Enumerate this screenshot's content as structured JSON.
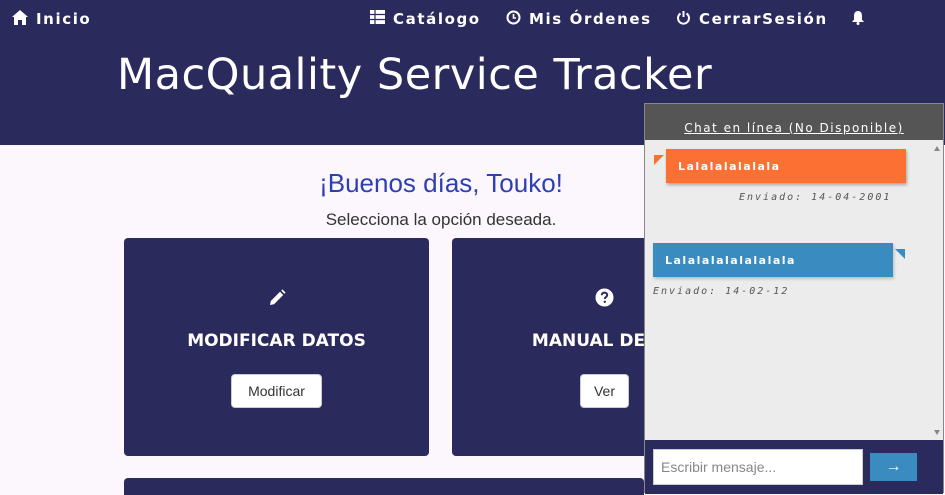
{
  "nav": {
    "home": {
      "label": "Inicio",
      "icon": "home-icon"
    },
    "catalog": {
      "label": "Catálogo",
      "icon": "grid-icon"
    },
    "orders": {
      "label": "Mis Órdenes",
      "icon": "clock-icon"
    },
    "logout": {
      "label": "CerrarSesión",
      "icon": "power-icon"
    },
    "notifications": {
      "icon": "bell-icon"
    }
  },
  "app_title": "MacQuality Service Tracker",
  "greeting": "¡Buenos días, Touko!",
  "subtitle": "Selecciona la opción deseada.",
  "cards": [
    {
      "title": "MODIFICAR DATOS",
      "button": "Modificar",
      "icon": "pencil-icon"
    },
    {
      "title": "MANUAL DE US",
      "button": "Ver",
      "icon": "question-circle-icon"
    }
  ],
  "chat": {
    "header": "Chat en línea (No Disponible)",
    "messages": [
      {
        "text": "Lalalalalalala",
        "sent": "Enviado: 14-04-2001"
      },
      {
        "text": "Lalalalalalalalala",
        "sent": "Enviado: 14-02-12"
      }
    ],
    "input_placeholder": "Escribir mensaje...",
    "send_label": "→"
  },
  "colors": {
    "navy": "#2b2a5c",
    "orange": "#fc7133",
    "blue": "#3a8cc0",
    "greeting": "#2f3fb3"
  }
}
